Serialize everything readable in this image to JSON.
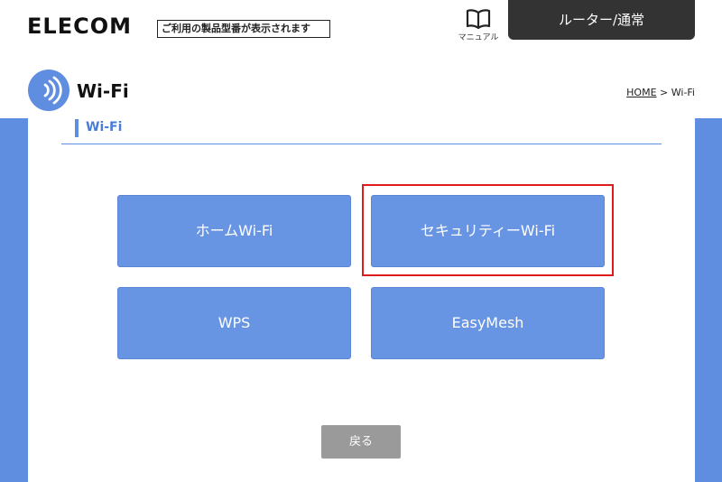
{
  "header": {
    "logo": "ELECOM",
    "model_notice": "ご利用の製品型番が表示されます",
    "manual_label": "マニュアル",
    "manual_icon": "book-icon",
    "mode_tab": "ルーター/通常"
  },
  "page": {
    "title": "Wi-Fi",
    "title_icon": "wifi-signal-icon",
    "breadcrumb_home": "HOME",
    "breadcrumb_sep": ">",
    "breadcrumb_current": "Wi-Fi"
  },
  "section": {
    "title": "Wi-Fi"
  },
  "menu": {
    "home_wifi": "ホームWi-Fi",
    "security_wifi": "セキュリティーWi-Fi",
    "wps": "WPS",
    "easymesh": "EasyMesh"
  },
  "footer": {
    "back": "戻る"
  },
  "colors": {
    "accent": "#5f8ee0",
    "button": "#6795e4",
    "highlight": "#e01b1b",
    "back_button": "#9a9a9a",
    "mode_tab": "#333333"
  }
}
